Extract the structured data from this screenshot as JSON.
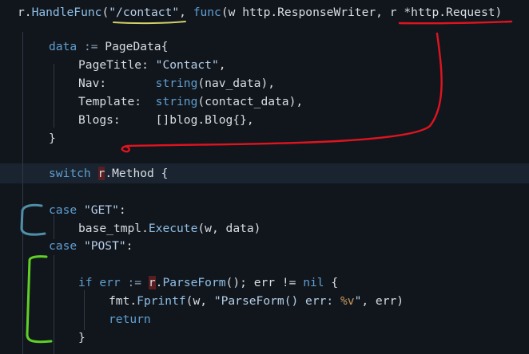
{
  "editor": {
    "colors": {
      "background": "#11161d",
      "current_line": "#1a2430",
      "keyword": "#5f9fd1",
      "function": "#8fbfe6",
      "string": "#b6cfe6",
      "identifier": "#d8dde3",
      "annotation_red": "#e0141e",
      "annotation_green": "#5fd026",
      "annotation_blue": "#4f8fa8",
      "annotation_yellow": "#d6cf6a"
    },
    "lines": [
      {
        "tokens": [
          {
            "t": "r.",
            "c": "id"
          },
          {
            "t": "HandleFunc",
            "c": "fn"
          },
          {
            "t": "(",
            "c": "id"
          },
          {
            "t": "\"/contact\"",
            "c": "str"
          },
          {
            "t": ", ",
            "c": "id"
          },
          {
            "t": "func",
            "c": "kw"
          },
          {
            "t": "(w http.ResponseWriter, ",
            "c": "id"
          },
          {
            "t": "r",
            "c": "id"
          },
          {
            "t": " *http.Request)",
            "c": "id"
          }
        ]
      },
      {
        "tokens": []
      },
      {
        "tokens": [
          {
            "t": "data ",
            "c": "kw"
          },
          {
            "t": ":= ",
            "c": "op"
          },
          {
            "t": "PageData{",
            "c": "id"
          }
        ]
      },
      {
        "tokens": [
          {
            "t": "PageTitle: ",
            "c": "id"
          },
          {
            "t": "\"Contact\"",
            "c": "str"
          },
          {
            "t": ",",
            "c": "id"
          }
        ]
      },
      {
        "tokens": [
          {
            "t": "Nav:       ",
            "c": "id"
          },
          {
            "t": "string",
            "c": "kw"
          },
          {
            "t": "(nav_data),",
            "c": "id"
          }
        ]
      },
      {
        "tokens": [
          {
            "t": "Template:  ",
            "c": "id"
          },
          {
            "t": "string",
            "c": "kw"
          },
          {
            "t": "(contact_data),",
            "c": "id"
          }
        ]
      },
      {
        "tokens": [
          {
            "t": "Blogs:     ",
            "c": "id"
          },
          {
            "t": "[]blog.Blog{},",
            "c": "id"
          }
        ]
      },
      {
        "tokens": [
          {
            "t": "}",
            "c": "id"
          }
        ]
      },
      {
        "tokens": []
      },
      {
        "tokens": [
          {
            "t": "switch ",
            "c": "kw"
          },
          {
            "t": "r",
            "c": "id",
            "hl": true
          },
          {
            "t": ".Method {",
            "c": "id"
          }
        ]
      },
      {
        "tokens": []
      },
      {
        "tokens": [
          {
            "t": "case ",
            "c": "kw"
          },
          {
            "t": "\"GET\"",
            "c": "str"
          },
          {
            "t": ":",
            "c": "id"
          }
        ]
      },
      {
        "tokens": [
          {
            "t": "base_tmpl.",
            "c": "id"
          },
          {
            "t": "Execute",
            "c": "fn"
          },
          {
            "t": "(w, data)",
            "c": "id"
          }
        ]
      },
      {
        "tokens": [
          {
            "t": "case ",
            "c": "kw"
          },
          {
            "t": "\"POST\"",
            "c": "str"
          },
          {
            "t": ":",
            "c": "id"
          }
        ]
      },
      {
        "tokens": []
      },
      {
        "tokens": [
          {
            "t": "if ",
            "c": "kw"
          },
          {
            "t": "err ",
            "c": "kw"
          },
          {
            "t": ":= ",
            "c": "op"
          },
          {
            "t": "r",
            "c": "id",
            "hl": true
          },
          {
            "t": ".",
            "c": "id"
          },
          {
            "t": "ParseForm",
            "c": "fn"
          },
          {
            "t": "(); err != ",
            "c": "id"
          },
          {
            "t": "nil",
            "c": "kw"
          },
          {
            "t": " {",
            "c": "id"
          }
        ]
      },
      {
        "tokens": [
          {
            "t": "fmt.",
            "c": "id"
          },
          {
            "t": "Fprintf",
            "c": "fn"
          },
          {
            "t": "(w, ",
            "c": "id"
          },
          {
            "t": "\"ParseForm() err: ",
            "c": "str"
          },
          {
            "t": "%v",
            "c": "sym"
          },
          {
            "t": "\"",
            "c": "str"
          },
          {
            "t": ", err)",
            "c": "id"
          }
        ]
      },
      {
        "tokens": [
          {
            "t": "return",
            "c": "kw"
          }
        ]
      },
      {
        "tokens": [
          {
            "t": "}",
            "c": "id"
          }
        ]
      }
    ]
  }
}
